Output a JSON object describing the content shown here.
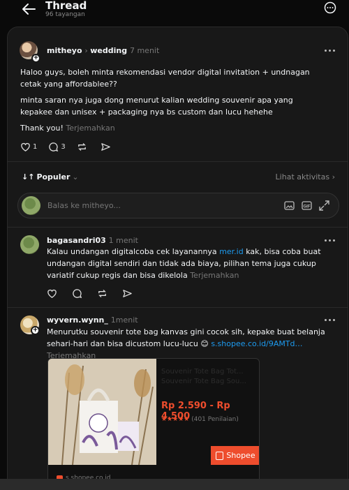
{
  "header": {
    "title": "Thread",
    "views": "96 tayangan"
  },
  "post": {
    "author": "mitheyo",
    "topic": "wedding",
    "time": "7 menit",
    "p1": "Haloo guys, boleh minta rekomendasi vendor digital invitation + undnagan cetak yang affordablee??",
    "p2": "minta saran nya juga dong menurut kalian wedding souvenir apa yang kepakee dan unisex + packaging nya bs custom dan lucu hehehe",
    "p3": "Thank you!",
    "translate": "Terjemahkan",
    "likes": "1",
    "replies": "3"
  },
  "sort": {
    "label": "Populer",
    "activity": "Lihat aktivitas"
  },
  "reply_box": {
    "placeholder": "Balas ke mitheyo..."
  },
  "replies": [
    {
      "author": "bagasandri03",
      "time": "1 menit",
      "text_before": "Kalau undangan digitalcoba cek layanannya ",
      "link": "mer.id",
      "text_after": " kak, bisa coba buat undangan digital sendiri dan tidak ada biaya, pilihan tema juga cukup variatif cukup regis dan bisa dikelola",
      "translate": "Terjemahkan"
    },
    {
      "author": "wyvern.wynn_",
      "time": "1menit",
      "text": "Menurutku souvenir tote bag kanvas gini cocok sih, kepake buat belanja sehari-hari dan bisa dicustom lucu-lucu",
      "emoji": "😊",
      "link": "s.shopee.co.id/9AMTd…",
      "translate": "Terjemahkan"
    }
  ],
  "product": {
    "title": "Souvenir Tote Bag Tot... Souvenir Tote Bag Sou...",
    "price": "Rp 2.590 - Rp 4.500",
    "stars": "★★★★★",
    "rating": "(401 Penilaian)",
    "badge": "Shopee",
    "domain": "s.shopee.co.id"
  },
  "colors": {
    "accent_link": "#1d9bf0",
    "shopee": "#ee4d2d",
    "bg": "#0a0a0a",
    "card": "#181818"
  }
}
